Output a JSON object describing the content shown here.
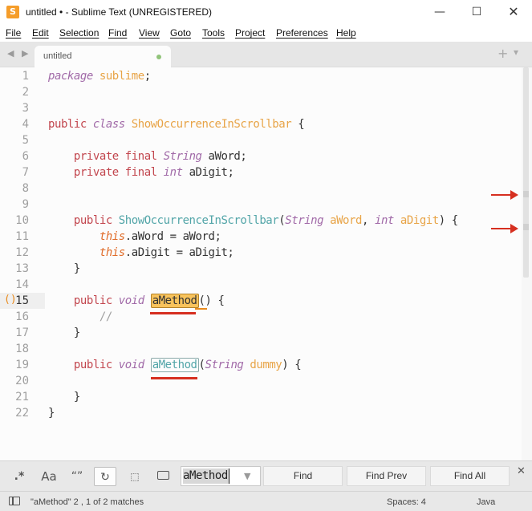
{
  "window": {
    "title": "untitled • - Sublime Text (UNREGISTERED)",
    "app_icon": "S",
    "minimize_icon": "—",
    "maximize_icon": "☐",
    "close_icon": "✕"
  },
  "menu": [
    "File",
    "Edit",
    "Selection",
    "Find",
    "View",
    "Goto",
    "Tools",
    "Project",
    "Preferences",
    "Help"
  ],
  "tabs": {
    "nav_arrows": "◀ ▶",
    "active_tab": "untitled",
    "add_icon": "+",
    "overflow_icon": "▾"
  },
  "editor": {
    "line_numbers": [
      "1",
      "2",
      "3",
      "4",
      "5",
      "6",
      "7",
      "8",
      "9",
      "10",
      "11",
      "12",
      "13",
      "14",
      "15",
      "16",
      "17",
      "18",
      "19",
      "20",
      "21",
      "22"
    ],
    "current_line": "15",
    "fold_marker": "()"
  },
  "find_panel": {
    "regex_label": ".*",
    "case_label": "Aa",
    "whole_word_label": "“”",
    "wrap_label": "↻",
    "in_selection_label": "⬚",
    "query": "aMethod",
    "dropdown_icon": "▼",
    "find_label": "Find",
    "find_prev_label": "Find Prev",
    "find_all_label": "Find All",
    "close_icon": "✕"
  },
  "status": {
    "message": "\"aMethod\" 2 , 1 of 2 matches",
    "indentation": "Spaces: 4",
    "syntax": "Java"
  },
  "colors": {
    "match_highlight": "#f8c35c",
    "annotation_red": "#d62f20",
    "keyword": "#c2464e",
    "type": "#a16aa8",
    "class_name": "#e8a447",
    "function": "#52a5a8"
  }
}
